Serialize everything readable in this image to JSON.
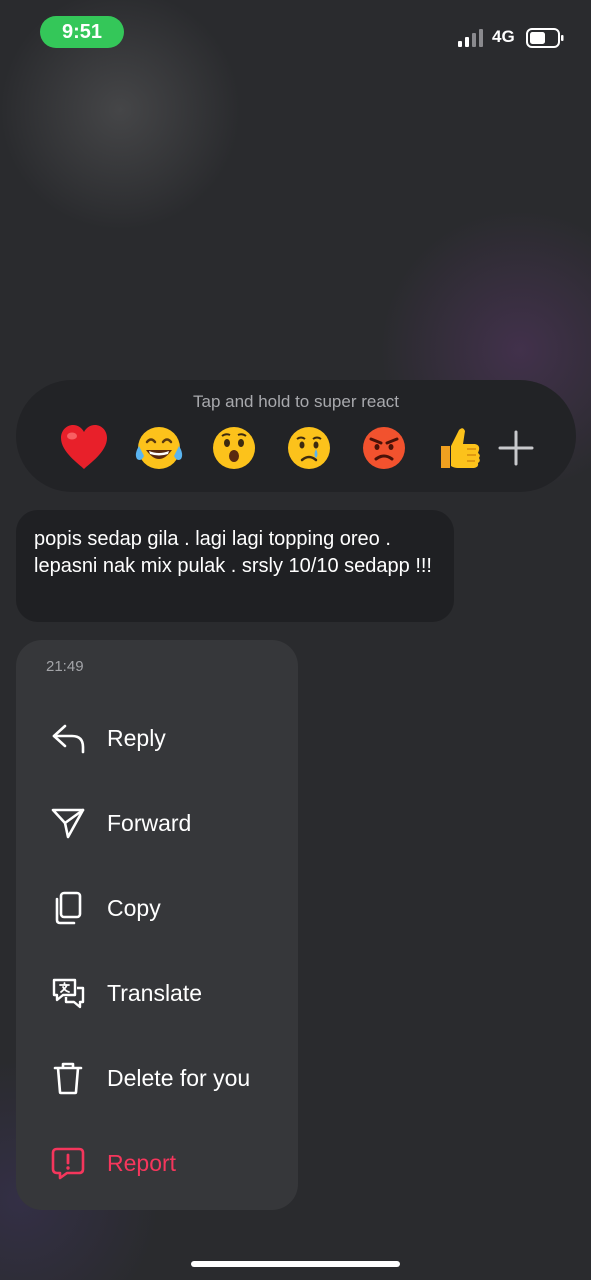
{
  "status_bar": {
    "time": "9:51",
    "network": "4G"
  },
  "reactions": {
    "hint": "Tap and hold to super react",
    "emojis": [
      {
        "icon": "red-heart-emoji"
      },
      {
        "icon": "tears-of-joy-emoji"
      },
      {
        "icon": "surprised-face-emoji"
      },
      {
        "icon": "crying-face-emoji"
      },
      {
        "icon": "angry-face-emoji"
      },
      {
        "icon": "thumbs-up-emoji"
      }
    ],
    "add_icon": "plus-icon"
  },
  "message": {
    "text": "popis sedap gila . lagi lagi topping oreo . lepasni nak mix pulak . srsly 10/10 sedapp !!!"
  },
  "menu": {
    "timestamp": "21:49",
    "items": [
      {
        "label": "Reply",
        "icon": "reply-icon"
      },
      {
        "label": "Forward",
        "icon": "send-icon"
      },
      {
        "label": "Copy",
        "icon": "copy-icon"
      },
      {
        "label": "Translate",
        "icon": "translate-icon"
      },
      {
        "label": "Delete for you",
        "icon": "trash-icon"
      },
      {
        "label": "Report",
        "icon": "report-icon",
        "color": "#f5365c"
      }
    ]
  },
  "colors": {
    "accent_green": "#34c759",
    "danger": "#f5365c"
  }
}
